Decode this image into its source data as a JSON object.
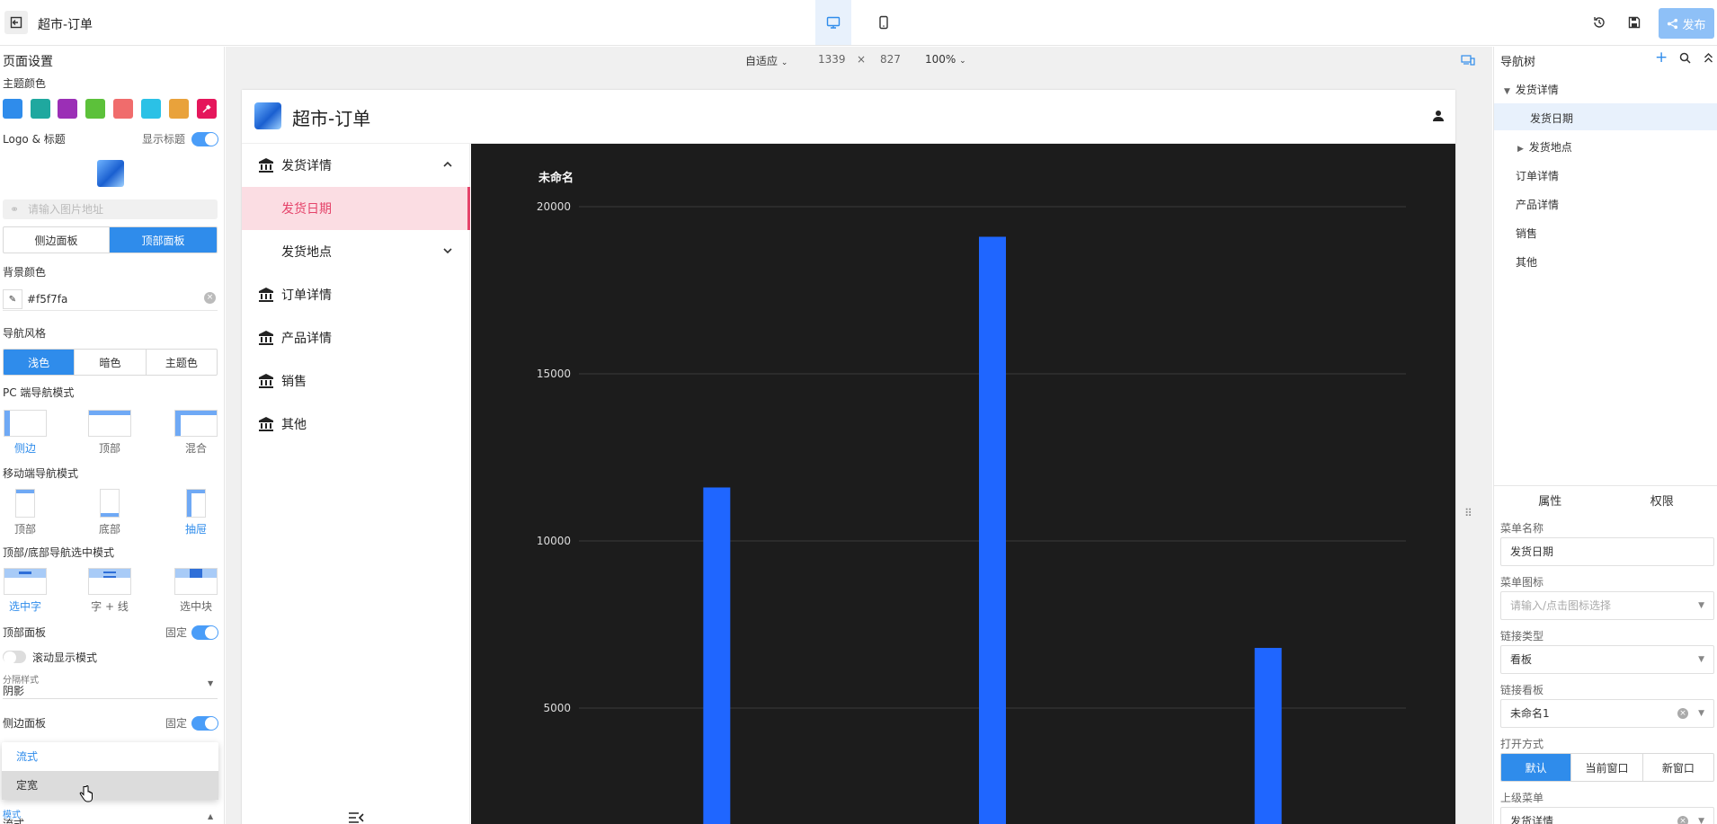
{
  "app": {
    "title": "超市-订单",
    "publish_label": "发布"
  },
  "left": {
    "page_settings": "页面设置",
    "theme_color": "主题颜色",
    "swatches": [
      "#2f8ceb",
      "#1fa89f",
      "#9b2fb6",
      "#5cc13a",
      "#f06c6c",
      "#2bc1e6",
      "#e9a23b"
    ],
    "logo_title": "Logo & 标题",
    "show_title": "显示标题",
    "url_placeholder": "请输入图片地址",
    "panel_side": "侧边面板",
    "panel_top": "顶部面板",
    "bg_color": "背景颜色",
    "bg_value": "#f5f7fa",
    "nav_style": "导航风格",
    "nav_light": "浅色",
    "nav_dark": "暗色",
    "nav_theme": "主题色",
    "pc_mode": "PC 端导航模式",
    "pc_side": "侧边",
    "pc_top": "顶部",
    "pc_mix": "混合",
    "mobile_mode": "移动端导航模式",
    "mb_top": "顶部",
    "mb_bottom": "底部",
    "mb_drawer": "抽屉",
    "select_mode": "顶部/底部导航选中模式",
    "sel_text": "选中字",
    "sel_line": "字 + 线",
    "sel_block": "选中块",
    "top_panel": "顶部面板",
    "fixed": "固定",
    "scroll_mode": "滚动显示模式",
    "split_style": "分隔样式",
    "split_value": "阴影",
    "side_panel": "侧边面板",
    "fixed2": "固定",
    "dd_opt1": "流式",
    "dd_opt2": "定宽",
    "mode_label": "模式",
    "mode_value": "流式"
  },
  "canvas": {
    "fit": "自适应",
    "width": "1339",
    "times": "×",
    "height": "827",
    "zoom": "100%"
  },
  "preview": {
    "title": "超市-订单",
    "nav": [
      {
        "label": "发货详情"
      },
      {
        "label": "发货日期"
      },
      {
        "label": "发货地点"
      },
      {
        "label": "订单详情"
      },
      {
        "label": "产品详情"
      },
      {
        "label": "销售"
      },
      {
        "label": "其他"
      }
    ]
  },
  "chart_data": {
    "type": "bar",
    "title": "未命名",
    "categories": [
      "",
      "",
      ""
    ],
    "values": [
      11600,
      19100,
      6800
    ],
    "ylim": [
      0,
      20000
    ],
    "yticks": [
      5000,
      10000,
      15000,
      20000
    ],
    "grid": true,
    "bar_color": "#1f66ff",
    "background": "#1c1c1c"
  },
  "right": {
    "nav_tree": "导航树",
    "tree": [
      "发货详情",
      "发货日期",
      "发货地点",
      "订单详情",
      "产品详情",
      "销售",
      "其他"
    ],
    "tab_props": "属性",
    "tab_perm": "权限",
    "menu_name_label": "菜单名称",
    "menu_name_value": "发货日期",
    "menu_icon_label": "菜单图标",
    "menu_icon_placeholder": "请输入/点击图标选择",
    "link_type_label": "链接类型",
    "link_type_value": "看板",
    "link_board_label": "链接看板",
    "link_board_value": "未命名1",
    "open_mode_label": "打开方式",
    "open_default": "默认",
    "open_current": "当前窗口",
    "open_new": "新窗口",
    "parent_menu_label": "上级菜单",
    "parent_menu_value": "发货详情"
  }
}
